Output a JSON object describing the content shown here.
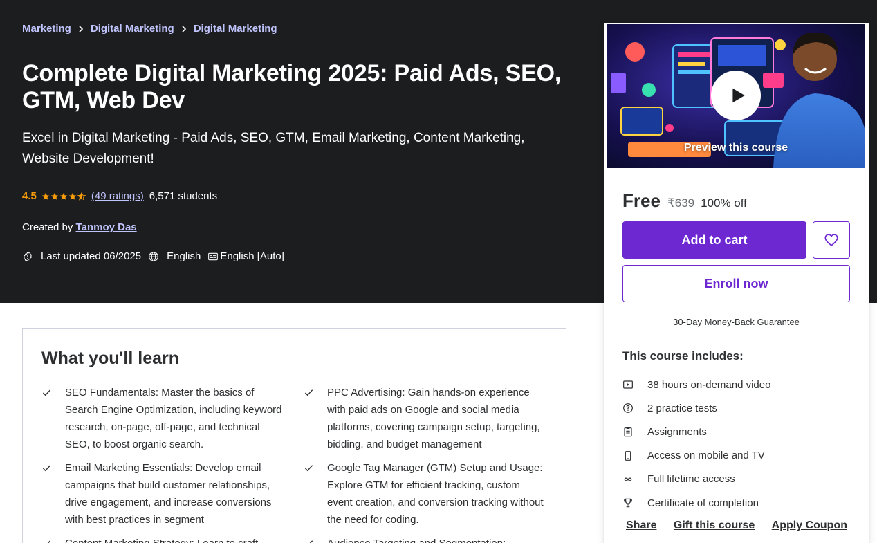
{
  "breadcrumb": [
    "Marketing",
    "Digital Marketing",
    "Digital Marketing"
  ],
  "course": {
    "title": "Complete Digital Marketing 2025: Paid Ads, SEO, GTM, Web Dev",
    "headline": "Excel in Digital Marketing - Paid Ads, SEO, GTM, Email Marketing, Content Marketing, Website Development!",
    "rating": "4.5",
    "rating_stars": 4.5,
    "ratings_count": "(49 ratings)",
    "students": "6,571 students",
    "created_by_label": "Created by",
    "instructor": "Tanmoy Das",
    "last_updated": "Last updated 06/2025",
    "language": "English",
    "captions": "English [Auto]"
  },
  "sidebar": {
    "preview_label": "Preview this course",
    "price": "Free",
    "original_price": "₹639",
    "discount": "100% off",
    "add_to_cart": "Add to cart",
    "enroll_now": "Enroll now",
    "guarantee": "30-Day Money-Back Guarantee",
    "includes_title": "This course includes:",
    "includes": [
      {
        "icon": "video-icon",
        "text": "38 hours on-demand video"
      },
      {
        "icon": "question-icon",
        "text": "2 practice tests"
      },
      {
        "icon": "clipboard-icon",
        "text": "Assignments"
      },
      {
        "icon": "mobile-icon",
        "text": "Access on mobile and TV"
      },
      {
        "icon": "infinity-icon",
        "text": "Full lifetime access"
      },
      {
        "icon": "trophy-icon",
        "text": "Certificate of completion"
      }
    ],
    "share": "Share",
    "gift": "Gift this course",
    "coupon": "Apply Coupon"
  },
  "learn": {
    "title": "What you'll learn",
    "items": [
      "SEO Fundamentals: Master the basics of Search Engine Optimization, including keyword research, on-page, off-page, and technical SEO, to boost organic search.",
      "PPC Advertising: Gain hands-on experience with paid ads on Google and social media platforms, covering campaign setup, targeting, bidding, and budget management",
      "Email Marketing Essentials: Develop email campaigns that build customer relationships, drive engagement, and increase conversions with best practices in segment",
      "Google Tag Manager (GTM) Setup and Usage: Explore GTM for efficient tracking, custom event creation, and conversion tracking without the need for coding.",
      "Content Marketing Strategy: Learn to craft",
      "Audience Targeting and Segmentation:"
    ]
  },
  "colors": {
    "hero_bg": "#1c1d1f",
    "link_purple": "#c0c4fc",
    "brand_purple": "#6d28d2",
    "star_orange": "#f69c08"
  }
}
